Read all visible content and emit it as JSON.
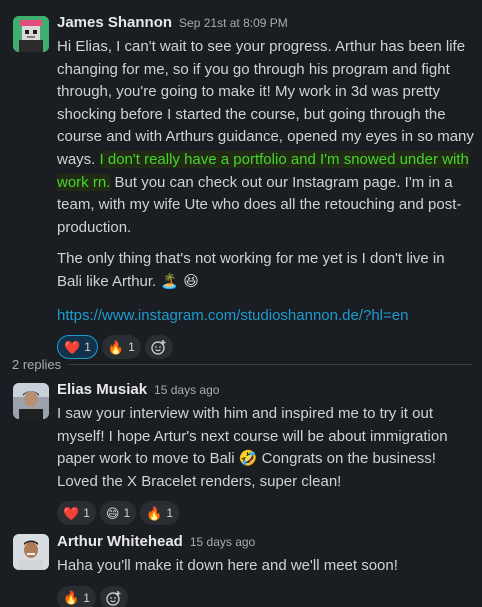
{
  "parent": {
    "author": "James Shannon",
    "timestamp": "Sep 21st at 8:09 PM",
    "lines": [
      "Hi Elias, I can't wait to see your progress. Arthur has been life",
      "changing for me, so if you go through his program and fight",
      "through, you're going to make it! My work in 3d was pretty",
      "shocking before I started the course, but going through the",
      "course and with Arthurs guidance, opened my eyes in so many"
    ],
    "line6_plain": "ways. ",
    "line6_highlight": "I don't really have a portfolio and I'm snowed under with",
    "line7_highlight": "work rn.",
    "line7_plain": " But you can check out our Instagram page. I'm in a",
    "line8": "team, with my wife Ute who does all the retouching and post-",
    "line9": "production.",
    "para2_line1": "The only thing that's not working for me yet is I don't live in",
    "para2_line2": "Bali like Arthur. ",
    "para2_emoji": "🏝️ 😆",
    "link": "https://www.instagram.com/studioshannon.de/?hl=en",
    "reactions": [
      {
        "emoji": "❤️",
        "count": "1",
        "active": true
      },
      {
        "emoji": "🔥",
        "count": "1",
        "active": false
      }
    ]
  },
  "replies_label": "2 replies",
  "replies": [
    {
      "author": "Elias Musiak",
      "timestamp": "15 days ago",
      "lines": [
        "I saw your interview with him and inspired me to try it out",
        "myself! I hope Artur's next course will be about immigration",
        "paper work to move to Bali 🤣 Congrats on the business!",
        "Loved the X Bracelet renders, super clean!"
      ],
      "reactions": [
        {
          "emoji": "❤️",
          "count": "1"
        },
        {
          "emoji": "😄",
          "count": "1"
        },
        {
          "emoji": "🔥",
          "count": "1"
        }
      ]
    },
    {
      "author": "Arthur Whitehead",
      "timestamp": "15 days ago",
      "lines": [
        "Haha you'll make it down here and we'll meet soon!"
      ],
      "reactions": [
        {
          "emoji": "🔥",
          "count": "1"
        }
      ]
    }
  ],
  "icons": {
    "add_reaction": "add-reaction-icon"
  },
  "colors": {
    "background": "#1a1d21",
    "highlight_text": "#44d62c",
    "link": "#1d9bd1",
    "active_reaction_border": "#1d9bd1"
  }
}
